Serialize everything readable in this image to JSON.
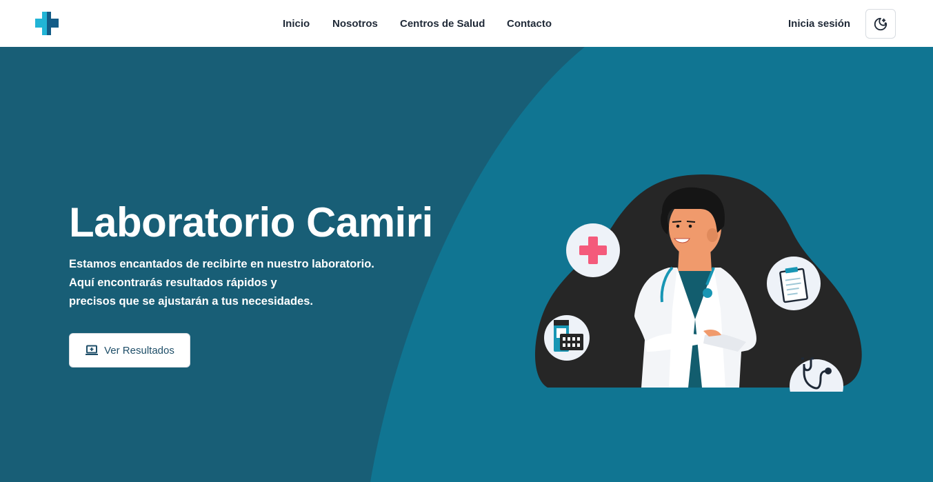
{
  "navbar": {
    "logo_icon": "medical-cross-icon",
    "links": [
      {
        "label": "Inicio"
      },
      {
        "label": "Nosotros"
      },
      {
        "label": "Centros de Salud"
      },
      {
        "label": "Contacto"
      }
    ],
    "signin_label": "Inicia sesión",
    "theme_toggle_icon": "moon-stars-icon"
  },
  "hero": {
    "title": "Laboratorio Camiri",
    "description_lines": [
      "Estamos encantados de recibirte en nuestro laboratorio.",
      "Aquí encontrarás resultados rápidos y",
      "precisos que se ajustarán a tus necesidades."
    ],
    "cta_label": "Ver Resultados",
    "cta_icon": "laptop-icon",
    "illustration": {
      "icons": [
        "plus-cross-icon",
        "clipboard-icon",
        "pill-bottle-icon",
        "stethoscope-icon"
      ]
    }
  },
  "colors": {
    "hero_dark": "#185e76",
    "hero_light": "#107592",
    "blob": "#262626",
    "accent_pink": "#f45a7b",
    "accent_teal": "#1896b4",
    "text_dark": "#1f2937"
  }
}
